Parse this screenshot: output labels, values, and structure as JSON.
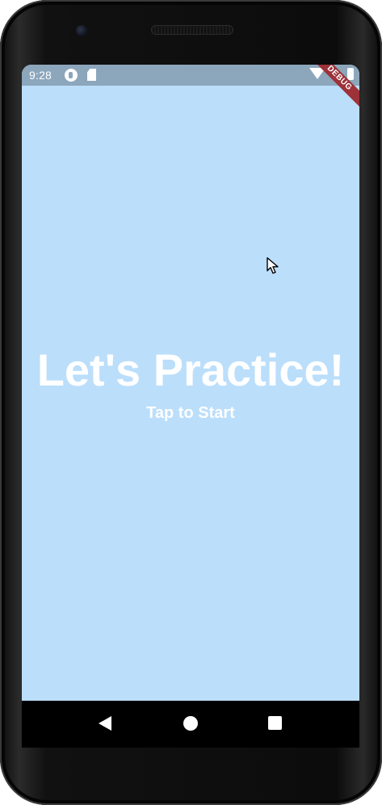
{
  "status_bar": {
    "time": "9:28",
    "icons": [
      "sync-icon",
      "sd-card-icon",
      "wifi-icon",
      "battery-icon"
    ],
    "debug_label": "DEBUG"
  },
  "screen": {
    "title": "Let's Practice!",
    "subtitle": "Tap to Start",
    "background_color": "#bbdefb",
    "text_color": "#ffffff"
  },
  "navigation": {
    "buttons": [
      "back",
      "home",
      "recents"
    ]
  }
}
